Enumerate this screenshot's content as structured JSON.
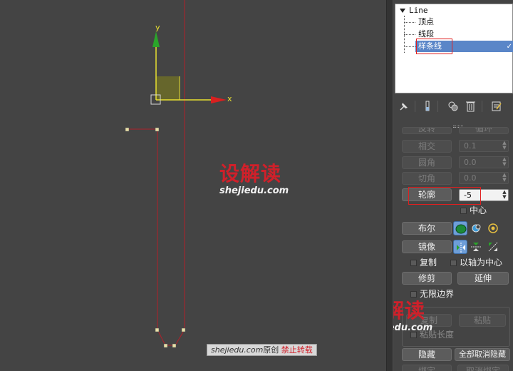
{
  "viewport": {
    "axis_y": "y",
    "axis_x": "x",
    "watermark_logo": "设解读",
    "watermark_url": "shejiedu.com",
    "credit_site": "shejiedu.com",
    "credit_mid": "原创",
    "credit_warn": "禁止转载"
  },
  "modifier_stack": {
    "root": "Line",
    "items": [
      "顶点",
      "线段",
      "样条线"
    ],
    "selected_index": 2,
    "check": "✓"
  },
  "toolbar": {
    "icons": [
      "pin-stack-icon",
      "show-end-result-icon",
      "make-unique-icon",
      "remove-modifier-icon",
      "configure-sets-icon"
    ]
  },
  "geometry": {
    "top_partial_left": "反转",
    "top_partial_right": "循环",
    "intersect_label": "相交",
    "intersect_value": "0.1",
    "fillet_label": "圆角",
    "fillet_value": "0.0",
    "chamfer_label": "切角",
    "chamfer_value": "0.0",
    "outline_label": "轮廓",
    "outline_value": "-5",
    "center_label": "中心",
    "boolean_label": "布尔",
    "mirror_label": "镜像",
    "copy_label": "复制",
    "about_pivot_label": "以轴为中心",
    "trim_label": "修剪",
    "extend_label": "延伸",
    "infinite_bounds_label": "无限边界",
    "copy_btn_label": "复制",
    "paste_label": "粘贴",
    "paste_length_label": "粘贴长度",
    "hide_label": "隐藏",
    "unhide_all_label": "全部取消隐藏",
    "bottom_partial_left": "绑定",
    "bottom_partial_right": "取消绑定"
  },
  "colors": {
    "selection": "#5a86c8",
    "highlight_box": "#e02020",
    "spline": "#b0202a",
    "gizmo_y": "#2aa52a",
    "gizmo_x": "#d82020"
  }
}
